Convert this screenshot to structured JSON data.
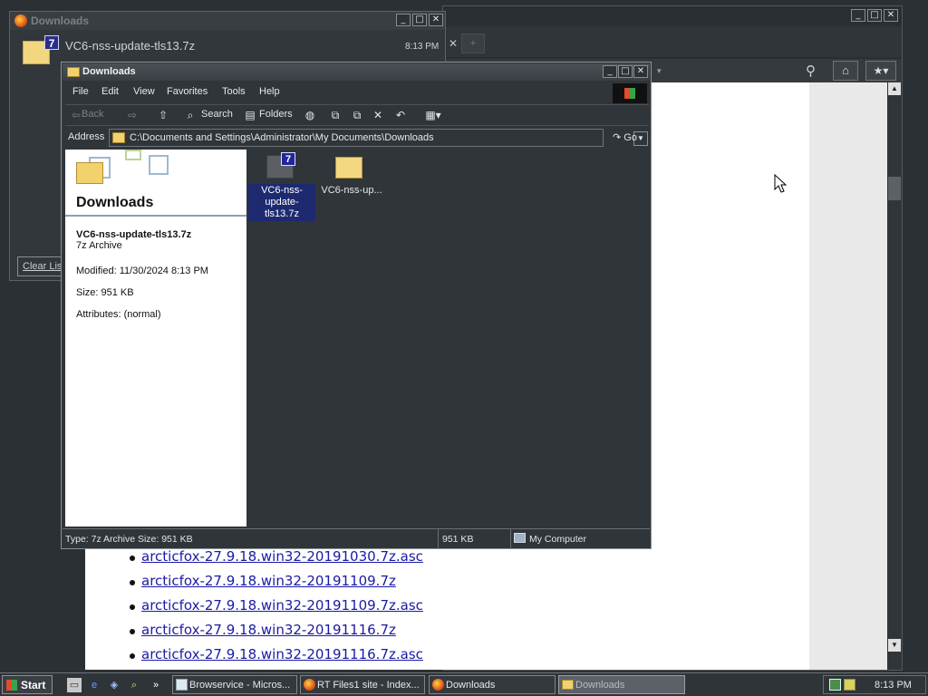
{
  "browser": {
    "window_buttons": [
      "_",
      "□",
      "✕"
    ],
    "links": [
      "arcticfox-27.9.18.win32-20191030.7z.asc",
      "arcticfox-27.9.18.win32-20191109.7z",
      "arcticfox-27.9.18.win32-20191109.7z.asc",
      "arcticfox-27.9.18.win32-20191116.7z",
      "arcticfox-27.9.18.win32-20191116.7z.asc"
    ]
  },
  "ff_downloads": {
    "title": "Downloads",
    "item_name": "VC6-nss-update-tls13.7z",
    "item_time": "8:13 PM",
    "clear_list_label": "Clear List"
  },
  "explorer": {
    "title": "Downloads",
    "menu": [
      "File",
      "Edit",
      "View",
      "Favorites",
      "Tools",
      "Help"
    ],
    "toolbar": {
      "back": "Back",
      "search": "Search",
      "folders": "Folders"
    },
    "address": {
      "label": "Address",
      "path": "C:\\Documents and Settings\\Administrator\\My Documents\\Downloads",
      "go": "Go"
    },
    "details": {
      "folder_title": "Downloads",
      "file_name": "VC6-nss-update-tls13.7z",
      "file_type": "7z Archive",
      "modified": "Modified: 11/30/2024 8:13 PM",
      "size": "Size: 951 KB",
      "attributes": "Attributes: (normal)"
    },
    "files": [
      {
        "name": "VC6-nss-update-tls13.7z",
        "selected": true,
        "icon": "7z-archive-icon"
      },
      {
        "name": "VC6-nss-up...",
        "selected": false,
        "icon": "folder-icon"
      }
    ],
    "status": {
      "info": "Type: 7z Archive Size: 951 KB",
      "size": "951 KB",
      "zone": "My Computer"
    }
  },
  "taskbar": {
    "start": "Start",
    "buttons": [
      {
        "label": "Browservice - Micros...",
        "icon": "ie-page-icon",
        "active": false
      },
      {
        "label": "RT Files1 site - Index...",
        "icon": "firefox-icon",
        "active": false
      },
      {
        "label": "Downloads",
        "icon": "firefox-icon",
        "active": false
      },
      {
        "label": "Downloads",
        "icon": "folder-icon",
        "active": true
      }
    ],
    "clock": "8:13 PM",
    "overflow": "»"
  },
  "colors": {
    "desktop": "#2b3035",
    "selection": "#1e2a70",
    "link": "#1a1aa6",
    "folder": "#f1d26d"
  }
}
